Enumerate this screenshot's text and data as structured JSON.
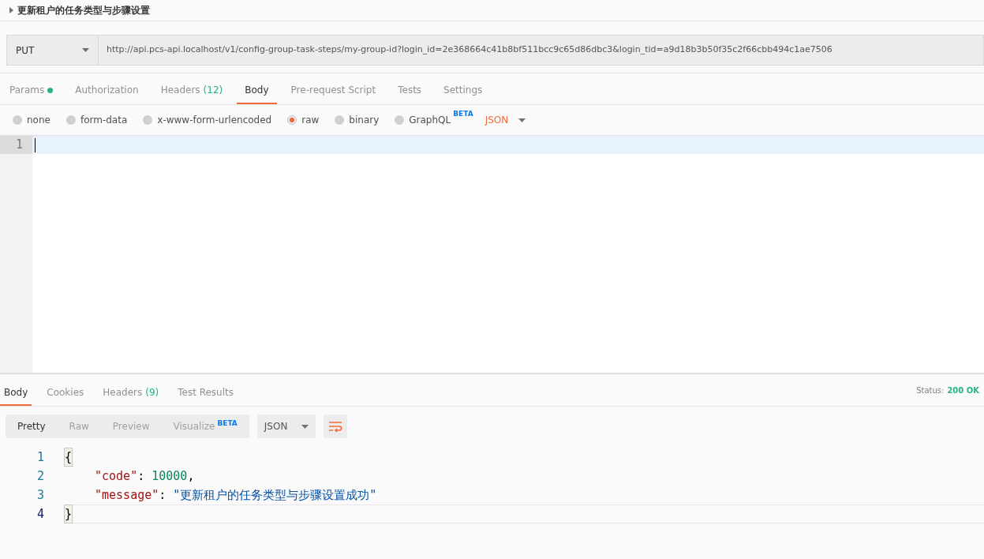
{
  "request": {
    "title": "更新租户的任务类型与步骤设置",
    "method": "PUT",
    "url": "http://api.pcs-api.localhost/v1/config-group-task-steps/my-group-id?login_id=2e368664c41b8bf511bcc9c65d86dbc3&login_tid=a9d18b3b50f35c2f66cbb494c1ae7506",
    "tabs": [
      {
        "label": "Params",
        "dot": true,
        "selected": false
      },
      {
        "label": "Authorization",
        "selected": false
      },
      {
        "label": "Headers",
        "count": "(12)",
        "selected": false
      },
      {
        "label": "Body",
        "selected": true
      },
      {
        "label": "Pre-request Script",
        "selected": false
      },
      {
        "label": "Tests",
        "selected": false
      },
      {
        "label": "Settings",
        "selected": false
      }
    ],
    "body_types": [
      {
        "label": "none",
        "selected": false
      },
      {
        "label": "form-data",
        "selected": false
      },
      {
        "label": "x-www-form-urlencoded",
        "selected": false
      },
      {
        "label": "raw",
        "selected": true
      },
      {
        "label": "binary",
        "selected": false
      },
      {
        "label": "GraphQL",
        "badge": "BETA",
        "selected": false
      }
    ],
    "format": "JSON",
    "editor_lines": [
      "1"
    ]
  },
  "response": {
    "tabs": [
      {
        "label": "Body",
        "selected": true
      },
      {
        "label": "Cookies",
        "selected": false
      },
      {
        "label": "Headers",
        "count": "(9)",
        "selected": false
      },
      {
        "label": "Test Results",
        "selected": false
      }
    ],
    "status_label": "Status:",
    "status_value": "200 OK",
    "view_modes": [
      {
        "label": "Pretty",
        "selected": true
      },
      {
        "label": "Raw",
        "selected": false
      },
      {
        "label": "Preview",
        "selected": false
      },
      {
        "label": "Visualize",
        "badge": "BETA",
        "selected": false
      }
    ],
    "format": "JSON",
    "lines": [
      {
        "number": "1",
        "tokens": [
          {
            "kind": "brace",
            "text": "{"
          }
        ]
      },
      {
        "number": "2",
        "tokens": [
          {
            "kind": "key",
            "text": "\"code\""
          },
          {
            "kind": "punct",
            "text": ": "
          },
          {
            "kind": "number",
            "text": "10000"
          },
          {
            "kind": "punct",
            "text": ","
          }
        ]
      },
      {
        "number": "3",
        "tokens": [
          {
            "kind": "key",
            "text": "\"message\""
          },
          {
            "kind": "punct",
            "text": ": "
          },
          {
            "kind": "string",
            "text": "\"更新租户的任务类型与步骤设置成功\""
          }
        ]
      },
      {
        "number": "4",
        "current": true,
        "tokens": [
          {
            "kind": "brace",
            "text": "}"
          }
        ]
      }
    ]
  }
}
